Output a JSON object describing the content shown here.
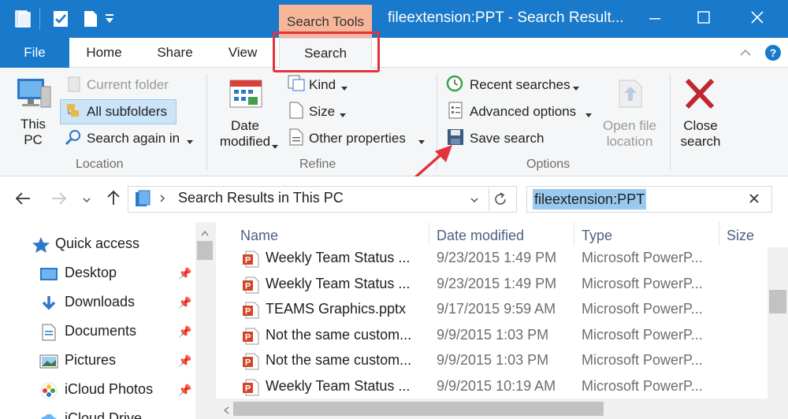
{
  "window": {
    "title": "fileextension:PPT - Search Result...",
    "contextual_tab": "Search Tools"
  },
  "tabs": {
    "file": "File",
    "home": "Home",
    "share": "Share",
    "view": "View",
    "search": "Search"
  },
  "ribbon": {
    "location": {
      "this_pc": [
        "This",
        "PC"
      ],
      "current_folder": "Current folder",
      "all_subfolders": "All subfolders",
      "search_again": "Search again in",
      "label": "Location"
    },
    "refine": {
      "date_modified": [
        "Date",
        "modified"
      ],
      "kind": "Kind",
      "size": "Size",
      "other_properties": "Other properties",
      "label": "Refine"
    },
    "options": {
      "recent_searches": "Recent searches",
      "advanced_options": "Advanced options",
      "save_search": "Save search",
      "open_file_location": [
        "Open file",
        "location"
      ],
      "label": "Options"
    },
    "close": {
      "label": [
        "Close",
        "search"
      ]
    }
  },
  "address": {
    "path": "Search Results in This PC",
    "search_query": "fileextension:PPT"
  },
  "nav_pane": [
    {
      "label": "Quick access",
      "icon": "star-icon",
      "pinned": false
    },
    {
      "label": "Desktop",
      "icon": "desktop-icon",
      "pinned": true
    },
    {
      "label": "Downloads",
      "icon": "downloads-icon",
      "pinned": true
    },
    {
      "label": "Documents",
      "icon": "documents-icon",
      "pinned": true
    },
    {
      "label": "Pictures",
      "icon": "pictures-icon",
      "pinned": true
    },
    {
      "label": "iCloud Photos",
      "icon": "icloud-photos-icon",
      "pinned": true
    },
    {
      "label": "iCloud Drive",
      "icon": "icloud-drive-icon",
      "pinned": false
    }
  ],
  "columns": {
    "name": "Name",
    "date_modified": "Date modified",
    "type": "Type",
    "size": "Size"
  },
  "files": [
    {
      "name": "Weekly Team Status ...",
      "date": "9/23/2015 1:49 PM",
      "type": "Microsoft PowerP..."
    },
    {
      "name": "Weekly Team Status ...",
      "date": "9/23/2015 1:49 PM",
      "type": "Microsoft PowerP..."
    },
    {
      "name": "TEAMS Graphics.pptx",
      "date": "9/17/2015 9:59 AM",
      "type": "Microsoft PowerP..."
    },
    {
      "name": "Not the same custom...",
      "date": "9/9/2015 1:03 PM",
      "type": "Microsoft PowerP..."
    },
    {
      "name": "Not the same custom...",
      "date": "9/9/2015 1:03 PM",
      "type": "Microsoft PowerP..."
    },
    {
      "name": "Weekly Team Status ...",
      "date": "9/9/2015 10:19 AM",
      "type": "Microsoft PowerP..."
    }
  ],
  "colors": {
    "title_bar": "#1979ca",
    "contextual_tab": "#f7b69a",
    "ribbon": "#f5f6f7",
    "annotation_red": "#e2323c",
    "selection": "#cce4f7"
  }
}
